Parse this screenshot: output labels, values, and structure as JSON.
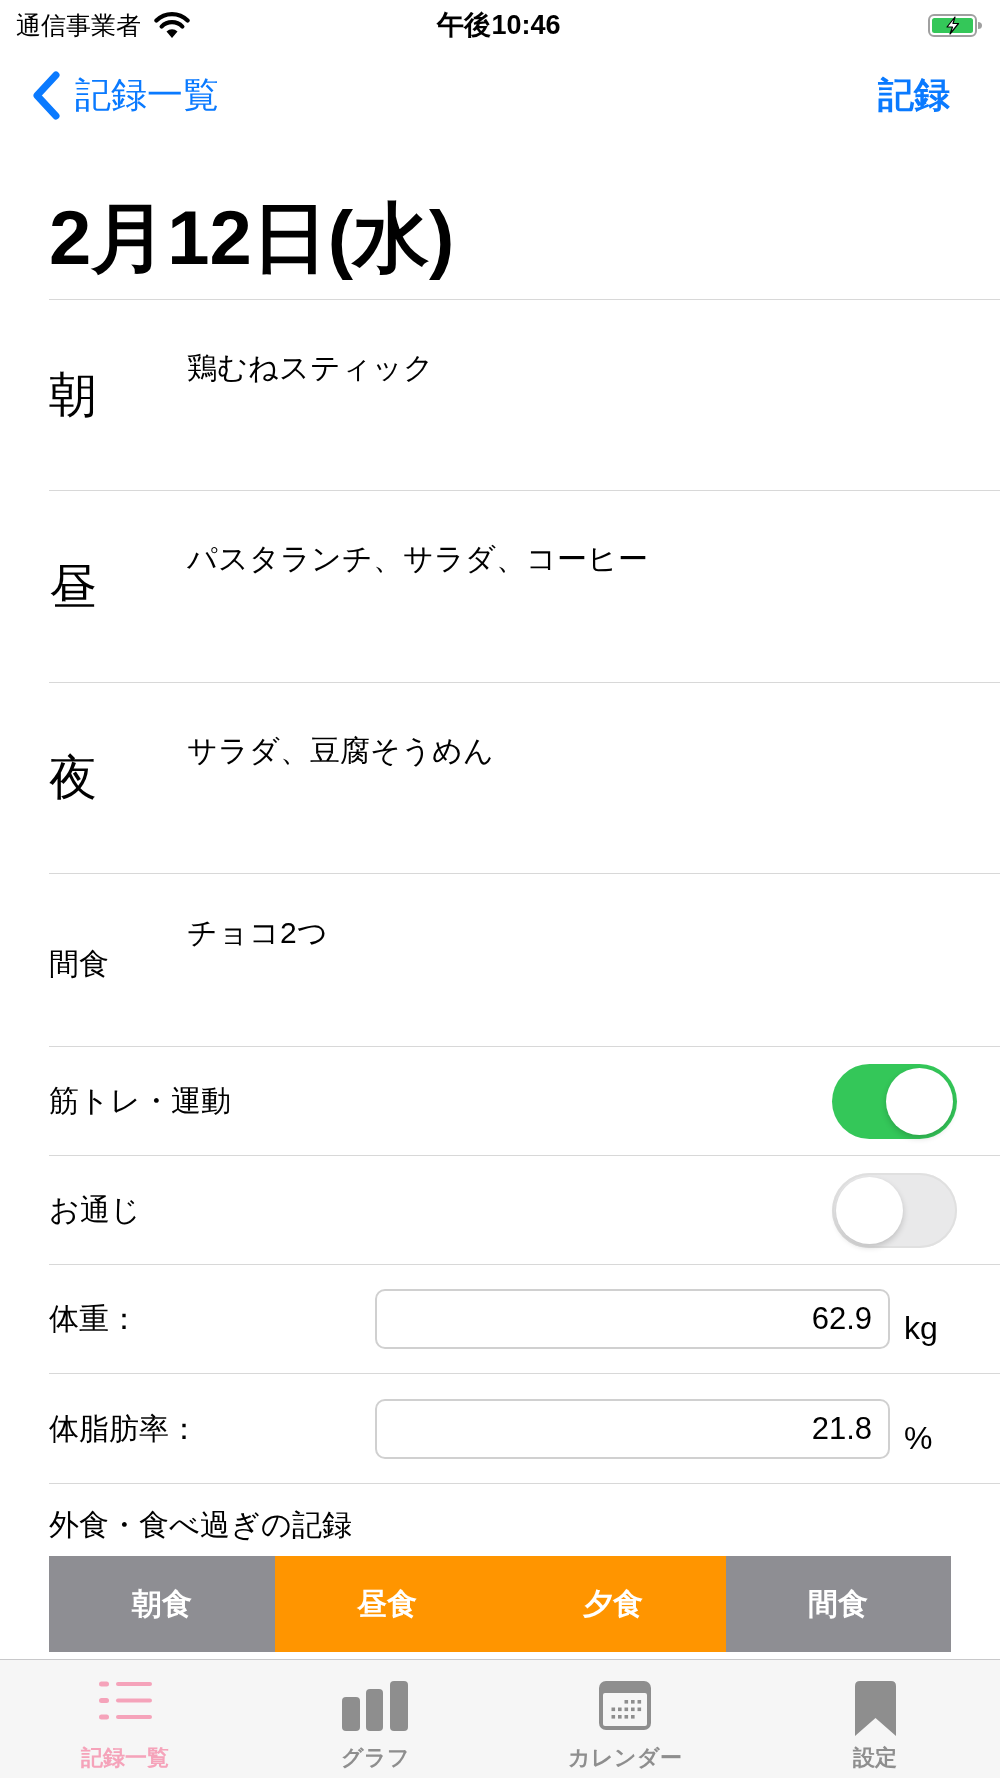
{
  "status_bar": {
    "carrier": "通信事業者",
    "time": "午後10:46"
  },
  "nav_bar": {
    "back_label": "記録一覧",
    "action": "記録"
  },
  "title": "2月12日(水)",
  "meals": [
    {
      "kind": "meal",
      "label": "朝",
      "text": "鶏むねスティック"
    },
    {
      "kind": "meal",
      "label": "昼",
      "text": "パスタランチ、サラダ、コーヒー"
    },
    {
      "kind": "meal",
      "label": "夜",
      "text": "サラダ、豆腐そうめん"
    },
    {
      "kind": "snack",
      "label": "間食",
      "text": "チョコ2つ"
    }
  ],
  "toggles": [
    {
      "label": "筋トレ・運動",
      "on": true
    },
    {
      "label": "お通じ",
      "on": false
    }
  ],
  "measurements": [
    {
      "label": "体重：",
      "value": "62.9",
      "unit": "kg"
    },
    {
      "label": "体脂肪率：",
      "value": "21.8",
      "unit": "%"
    }
  ],
  "eating_out": {
    "label": "外食・食べ過ぎの記録",
    "segments": [
      {
        "label": "朝食",
        "selected": false
      },
      {
        "label": "昼食",
        "selected": true
      },
      {
        "label": "夕食",
        "selected": true
      },
      {
        "label": "間食",
        "selected": false
      }
    ]
  },
  "tab_bar": {
    "tabs": [
      {
        "label": "記録一覧",
        "selected": true
      },
      {
        "label": "グラフ",
        "selected": false
      },
      {
        "label": "カレンダー",
        "selected": false
      },
      {
        "label": "設定",
        "selected": false
      }
    ]
  }
}
